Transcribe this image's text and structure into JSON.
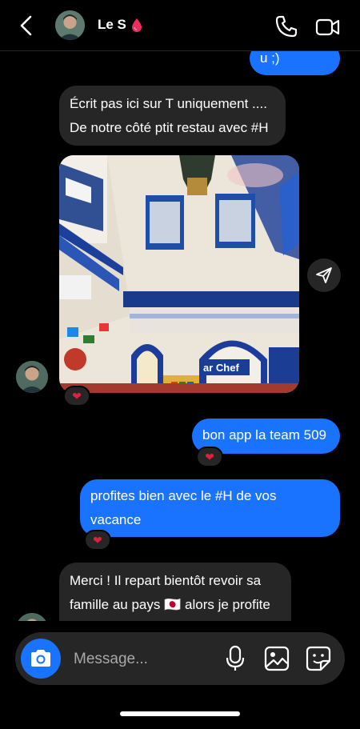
{
  "header": {
    "contact_name": "Le S",
    "icons": [
      "back-chevron-icon",
      "blood-drop-icon",
      "phone-icon",
      "video-camera-icon"
    ]
  },
  "messages": [
    {
      "side": "sent",
      "lines": [
        "u ;)"
      ]
    },
    {
      "side": "received",
      "lines": [
        "Écrit pas ici sur T uniquement ....",
        "De notre côté ptit restau avec #H"
      ]
    },
    {
      "side": "received",
      "type": "photo",
      "reaction": "❤"
    },
    {
      "side": "sent",
      "lines": [
        "bon app la team 509"
      ],
      "reaction": "❤"
    },
    {
      "side": "sent",
      "lines": [
        "profites bien avec le #H de vos",
        "vacance"
      ],
      "reaction": "❤"
    },
    {
      "side": "received",
      "lines": [
        "Merci ! Il repart bientôt revoir sa",
        "famille au pays 🇯🇵 alors je profite"
      ]
    }
  ],
  "photo": {
    "sign_text": "ar Chef"
  },
  "composer": {
    "placeholder": "Message...",
    "icons": [
      "camera-icon",
      "microphone-icon",
      "gallery-icon",
      "sticker-icon"
    ]
  },
  "colors": {
    "sent_bubble": "#1a73ff",
    "received_bubble": "#262626",
    "background": "#000000"
  }
}
